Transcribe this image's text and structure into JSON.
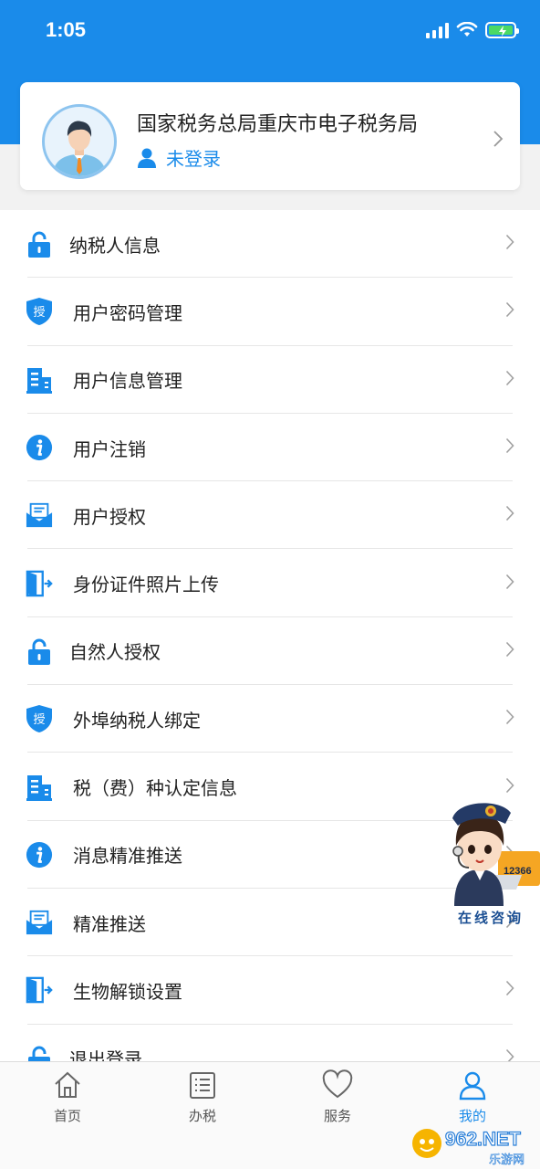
{
  "status": {
    "time": "1:05"
  },
  "profile": {
    "org_name": "国家税务总局重庆市电子税务局",
    "login_status": "未登录"
  },
  "menu": {
    "items": [
      {
        "label": "纳税人信息",
        "icon": "lock-icon"
      },
      {
        "label": "用户密码管理",
        "icon": "shield-auth-icon"
      },
      {
        "label": "用户信息管理",
        "icon": "building-icon"
      },
      {
        "label": "用户注销",
        "icon": "info-icon"
      },
      {
        "label": "用户授权",
        "icon": "mail-icon"
      },
      {
        "label": "身份证件照片上传",
        "icon": "door-exit-icon"
      },
      {
        "label": "自然人授权",
        "icon": "lock-icon"
      },
      {
        "label": "外埠纳税人绑定",
        "icon": "shield-auth-icon"
      },
      {
        "label": "税（费）种认定信息",
        "icon": "building-icon"
      },
      {
        "label": "消息精准推送",
        "icon": "info-icon"
      },
      {
        "label": "精准推送",
        "icon": "mail-icon"
      },
      {
        "label": "生物解锁设置",
        "icon": "door-exit-icon"
      },
      {
        "label": "退出登录",
        "icon": "lock-icon"
      }
    ],
    "shield_char": "授"
  },
  "consult": {
    "label": "在线咨询",
    "badge": "12366"
  },
  "tabs": [
    {
      "label": "首页",
      "icon": "home-icon",
      "active": false
    },
    {
      "label": "办税",
      "icon": "list-icon",
      "active": false
    },
    {
      "label": "服务",
      "icon": "heart-icon",
      "active": false
    },
    {
      "label": "我的",
      "icon": "user-icon",
      "active": true
    }
  ],
  "watermark": {
    "text": "962.NET",
    "sub": "乐游网"
  },
  "colors": {
    "primary": "#1a8bea",
    "text": "#222222",
    "divider": "#e6e6e6"
  }
}
